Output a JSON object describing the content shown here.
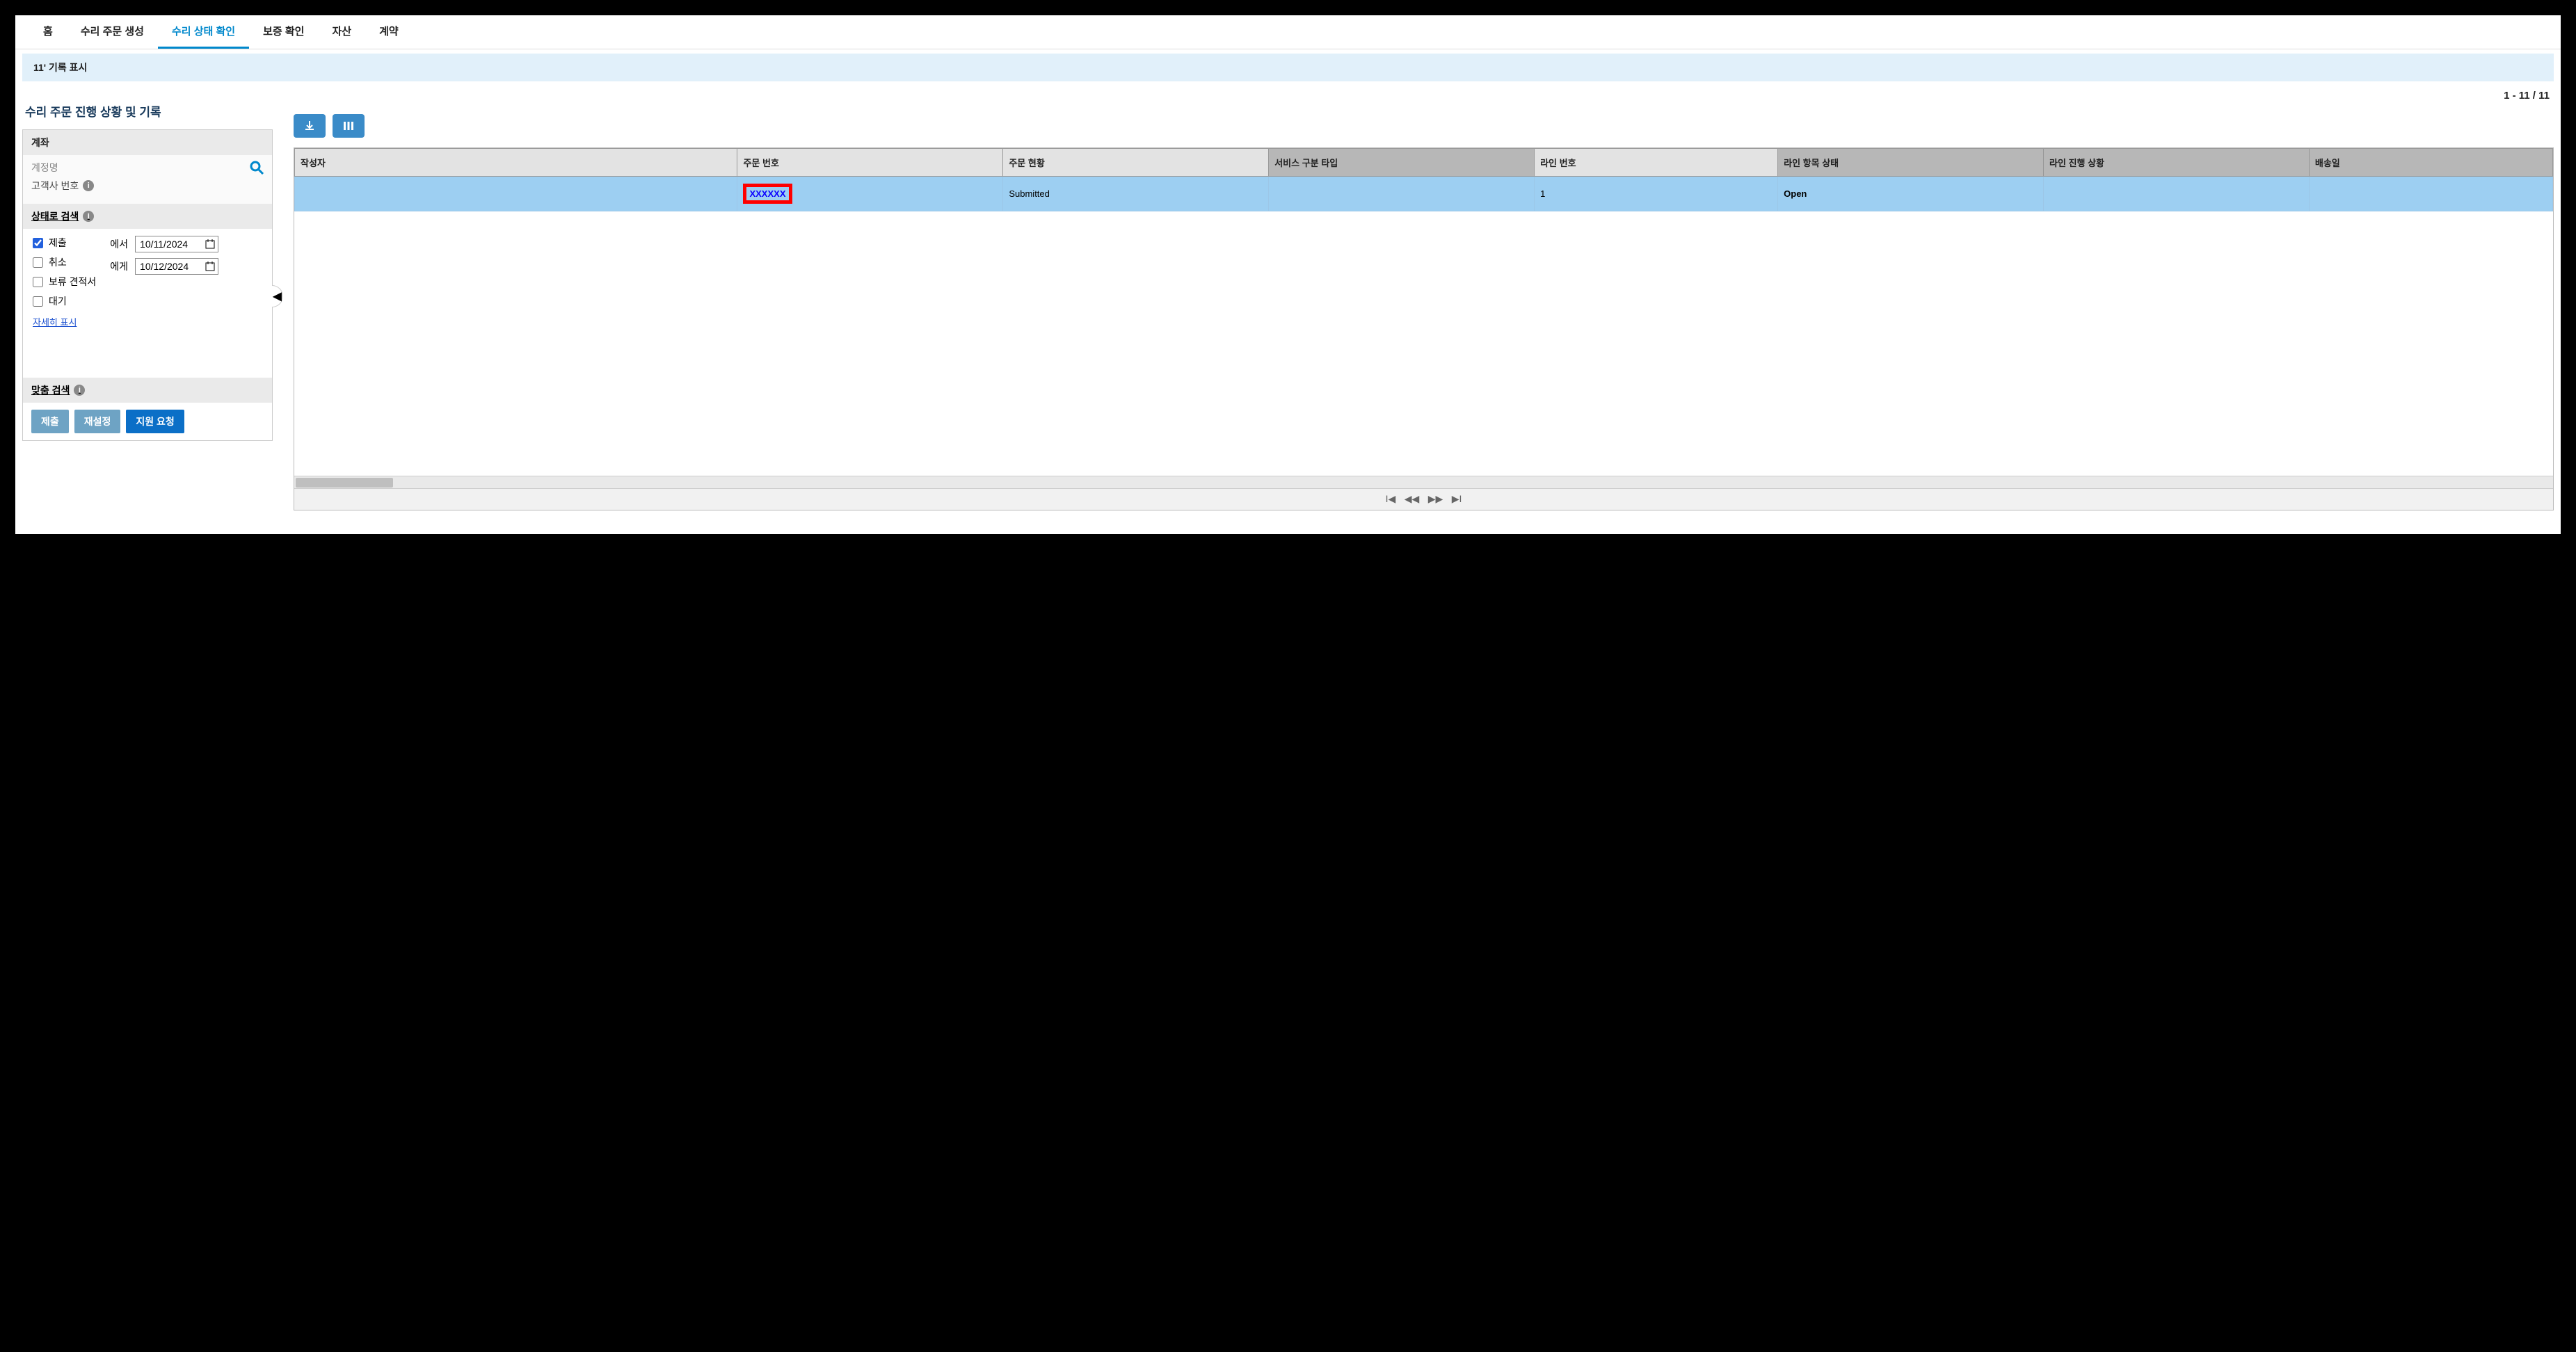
{
  "tabs": {
    "home": "홈",
    "create": "수리 주문 생성",
    "status": "수리 상태 확인",
    "warranty": "보증 확인",
    "asset": "자산",
    "contract": "계약"
  },
  "banner": "11' 기록 표시",
  "section_title": "수리 주문 진행 상황 및 기록",
  "account": {
    "header": "계좌",
    "placeholder": "계정명",
    "customer_no": "고객사 번호"
  },
  "status_search": {
    "header": "상태로 검색",
    "submitted": "제출",
    "cancelled": "취소",
    "pending": "보류 견적서",
    "waiting": "대기",
    "from_label": "에서",
    "to_label": "에게",
    "from_date": "10/11/2024",
    "to_date": "10/12/2024",
    "show_more": "자세히 표시"
  },
  "custom_search": {
    "header": "맞춤 검색"
  },
  "buttons": {
    "submit": "제출",
    "reset": "재설정",
    "support": "지원 요청"
  },
  "pagination": "1 - 11 / 11",
  "table": {
    "headers": {
      "author": "작성자",
      "order_no": "주문 번호",
      "order_status": "주문 현황",
      "service_type": "서비스 구분 타입",
      "line_no": "라인 번호",
      "line_item_status": "라인 항목 상태",
      "line_progress": "라인 진행 상황",
      "ship_date": "배송일"
    },
    "rows": [
      {
        "author": "",
        "order_no": "XXXXXX",
        "order_status": "Submitted",
        "service_type": "",
        "line_no": "1",
        "line_item_status": "Open",
        "line_progress": "",
        "ship_date": ""
      }
    ]
  },
  "pager": {
    "first": "⏮",
    "prev": "◀◀",
    "next": "▶▶",
    "last": "⏭"
  }
}
